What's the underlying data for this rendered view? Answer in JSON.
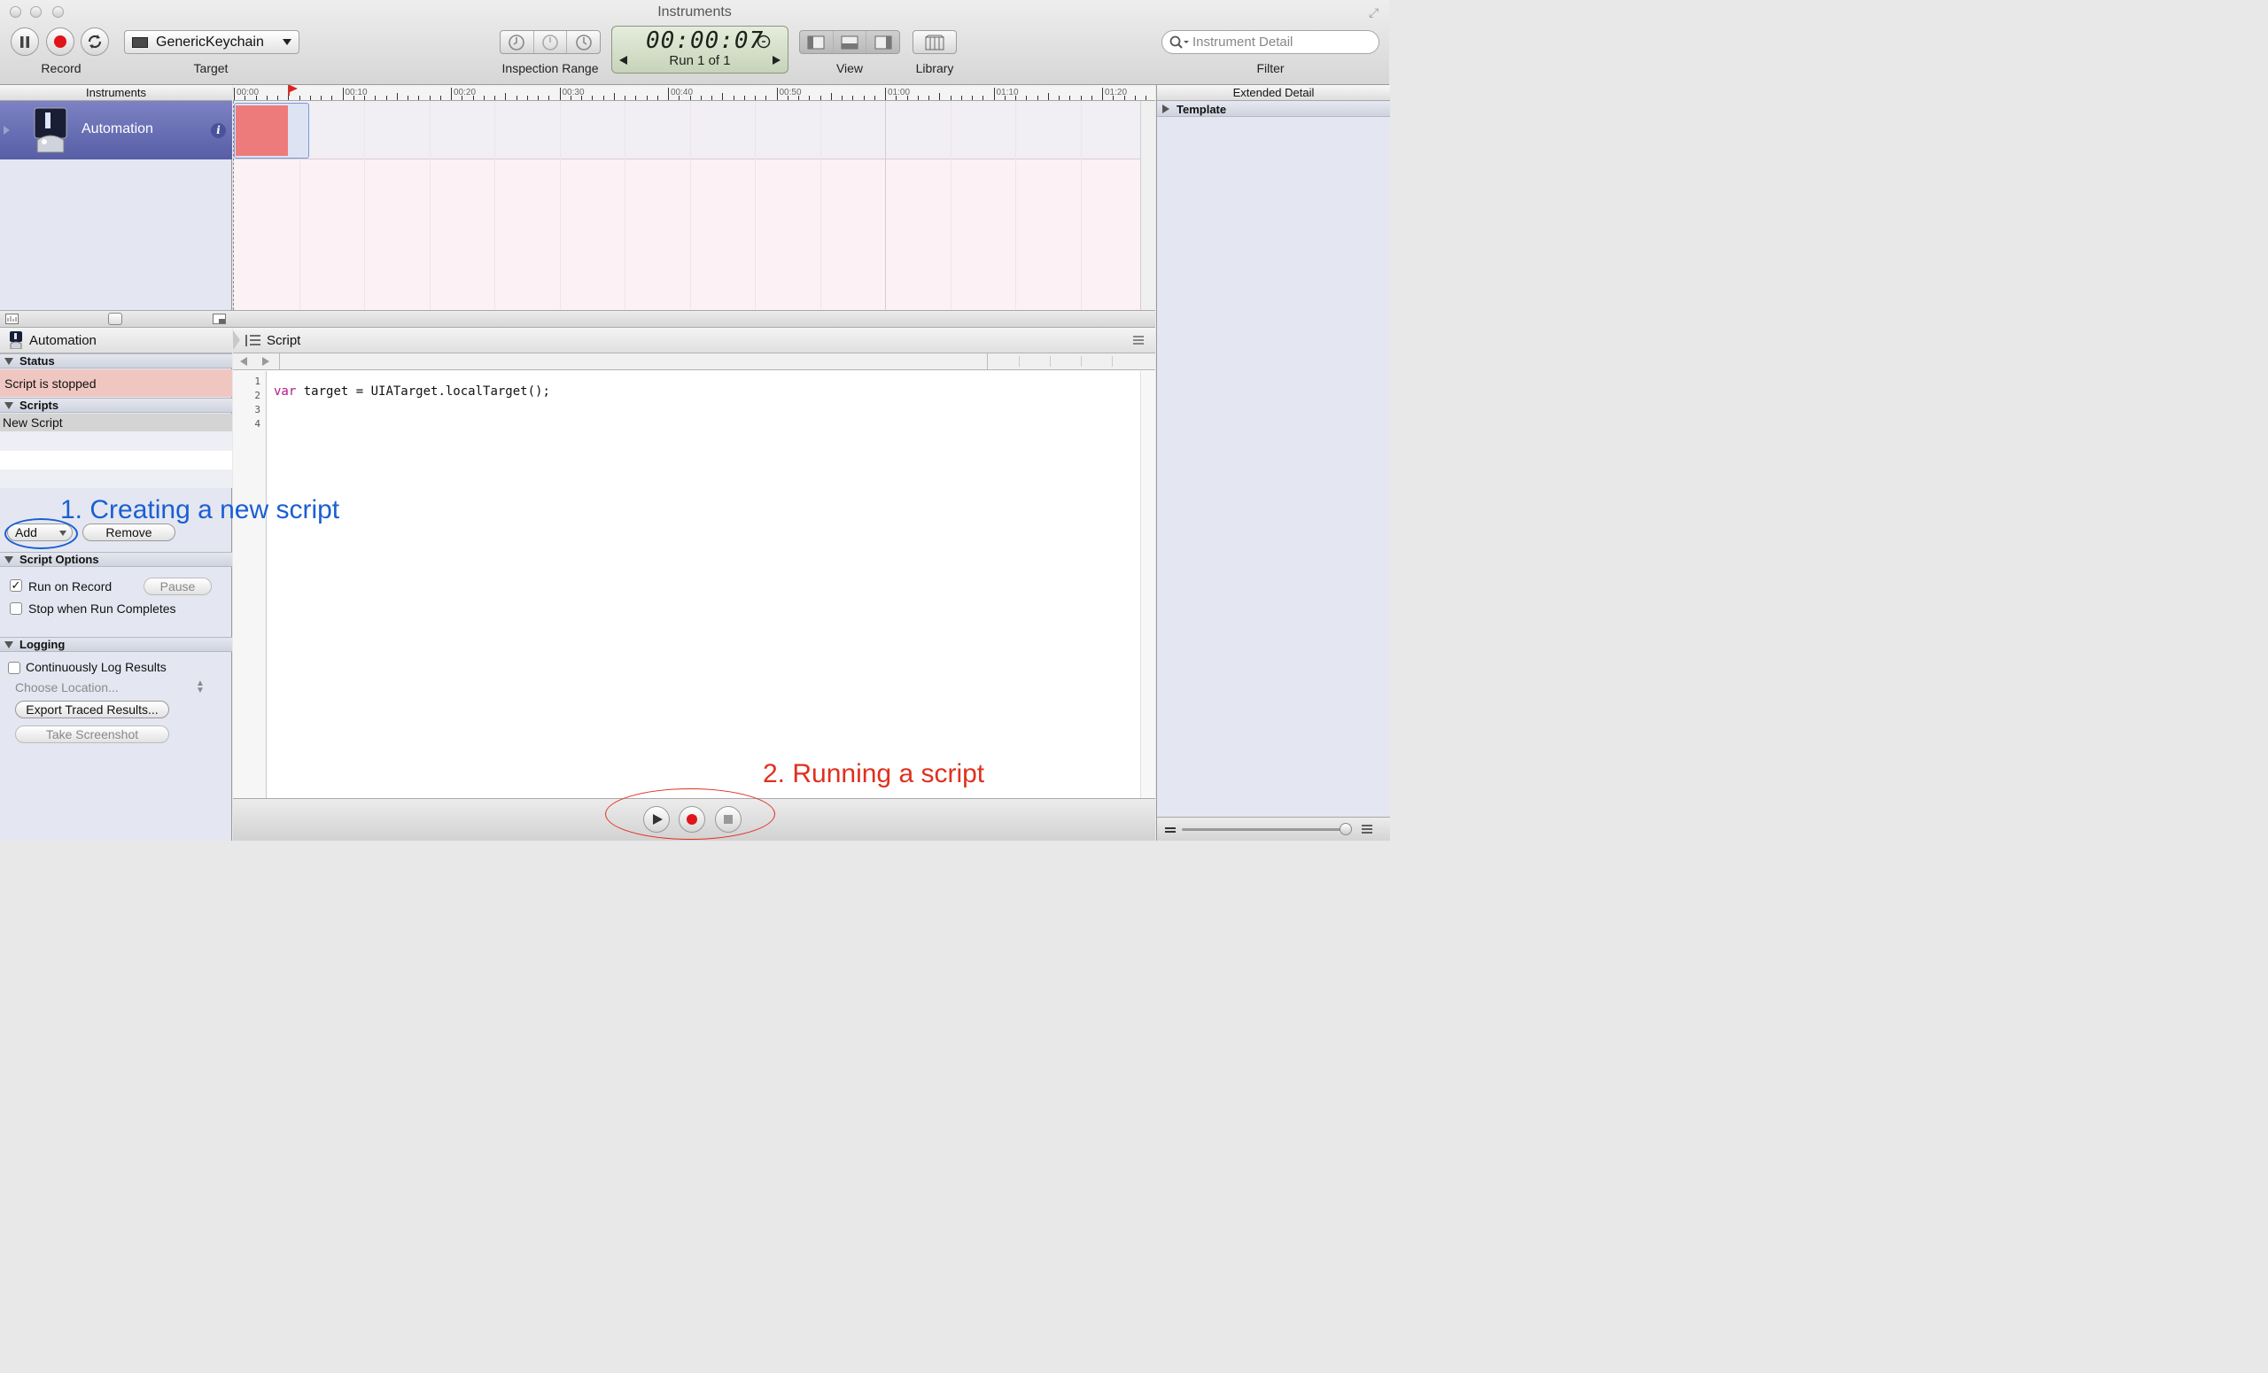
{
  "window": {
    "title": "Instruments"
  },
  "toolbar": {
    "record_label": "Record",
    "target_label": "Target",
    "target_value": "GenericKeychain",
    "inspection_range_label": "Inspection Range",
    "timer": "00:00:07",
    "run": "Run 1 of 1",
    "view_label": "View",
    "library_label": "Library",
    "search_placeholder": "Instrument Detail",
    "filter_label": "Filter"
  },
  "headers": {
    "instruments": "Instruments",
    "extended_detail": "Extended Detail"
  },
  "timeline": {
    "ticks": [
      "00:00",
      "00:10",
      "00:20",
      "00:30",
      "00:40",
      "00:50",
      "01:00",
      "01:10",
      "01:20"
    ]
  },
  "instrument": {
    "name": "Automation"
  },
  "extended": {
    "template_label": "Template"
  },
  "left_panel": {
    "title": "Automation",
    "status_header": "Status",
    "status_text": "Script is stopped",
    "scripts_header": "Scripts",
    "scripts": [
      "New Script"
    ],
    "add_label": "Add",
    "remove_label": "Remove",
    "options_header": "Script Options",
    "run_on_record": "Run on Record",
    "run_on_record_checked": true,
    "pause_label": "Pause",
    "stop_when_complete": "Stop when Run Completes",
    "logging_header": "Logging",
    "continuous_log": "Continuously Log Results",
    "choose_location": "Choose Location...",
    "export_label": "Export Traced Results...",
    "screenshot_label": "Take Screenshot"
  },
  "editor": {
    "title": "Script",
    "line_numbers": [
      "1",
      "2",
      "3",
      "4"
    ],
    "code_keyword": "var",
    "code_rest": " target = UIATarget.localTarget();"
  },
  "annotations": {
    "create": "1. Creating a new script",
    "run": "2. Running a script",
    "create_color": "#1a5fd1",
    "run_color": "#e0301e"
  },
  "colors": {
    "record_red": "#e0141a",
    "instrument_row": "#6a70b6",
    "status_bg": "#f0c7c0"
  }
}
